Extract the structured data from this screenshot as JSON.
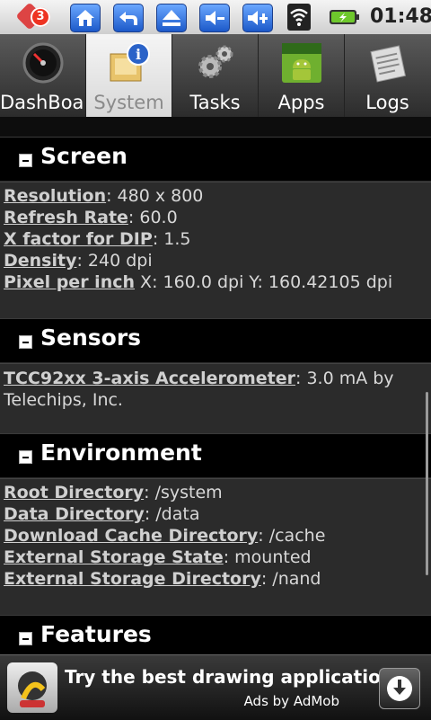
{
  "status": {
    "notification_count": "3",
    "time": "01:48"
  },
  "tabs": [
    {
      "label": "DashBoard",
      "icon": "speedometer-icon"
    },
    {
      "label": "System",
      "icon": "system-info-icon"
    },
    {
      "label": "Tasks",
      "icon": "gears-icon"
    },
    {
      "label": "Apps",
      "icon": "android-apps-icon"
    },
    {
      "label": "Logs",
      "icon": "logs-icon"
    }
  ],
  "sections": {
    "screen": {
      "title": "Screen",
      "rows": [
        {
          "key": "Resolution",
          "sep": ":",
          "value": " 480 x 800"
        },
        {
          "key": "Refresh Rate",
          "sep": ":",
          "value": " 60.0"
        },
        {
          "key": "X factor for DIP",
          "sep": ":",
          "value": " 1.5"
        },
        {
          "key": "Density",
          "sep": ":",
          "value": " 240 dpi"
        },
        {
          "key": "Pixel per inch",
          "sep": "",
          "value": " X: 160.0 dpi Y: 160.42105 dpi"
        }
      ]
    },
    "sensors": {
      "title": "Sensors",
      "rows": [
        {
          "key": "TCC92xx 3-axis Accelerometer",
          "sep": ":",
          "value": " 3.0 mA by Telechips, Inc."
        }
      ]
    },
    "environment": {
      "title": "Environment",
      "rows": [
        {
          "key": "Root Directory",
          "sep": ":",
          "value": " /system"
        },
        {
          "key": "Data Directory",
          "sep": ":",
          "value": " /data"
        },
        {
          "key": "Download Cache Directory",
          "sep": ":",
          "value": " /cache"
        },
        {
          "key": "External Storage State",
          "sep": ":",
          "value": " mounted"
        },
        {
          "key": "External Storage Directory",
          "sep": ":",
          "value": " /nand"
        }
      ]
    },
    "features": {
      "title": "Features"
    }
  },
  "ad": {
    "text": "Try the best drawing application!",
    "sub": "Ads by AdMob"
  }
}
